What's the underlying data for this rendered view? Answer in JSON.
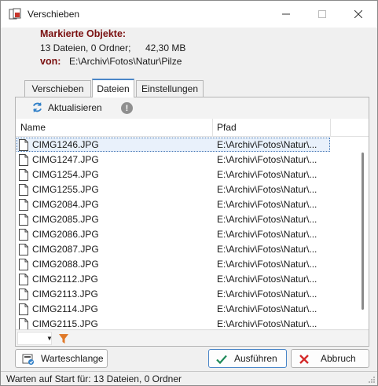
{
  "window": {
    "title": "Verschieben"
  },
  "header": {
    "marked_label": "Markierte Objekte:",
    "counts": "13 Dateien, 0 Ordner;",
    "size": "42,30 MB",
    "from_label": "von:",
    "from_path": "E:\\Archiv\\Fotos\\Natur\\Pilze"
  },
  "tabs": [
    {
      "label": "Verschieben"
    },
    {
      "label": "Dateien",
      "active": true
    },
    {
      "label": "Einstellungen"
    }
  ],
  "toolbar": {
    "refresh_label": "Aktualisieren",
    "warning_glyph": "!"
  },
  "list": {
    "columns": {
      "name": "Name",
      "path": "Pfad"
    },
    "rows": [
      {
        "name": "CIMG1246.JPG",
        "path": "E:\\Archiv\\Fotos\\Natur\\..."
      },
      {
        "name": "CIMG1247.JPG",
        "path": "E:\\Archiv\\Fotos\\Natur\\..."
      },
      {
        "name": "CIMG1254.JPG",
        "path": "E:\\Archiv\\Fotos\\Natur\\..."
      },
      {
        "name": "CIMG1255.JPG",
        "path": "E:\\Archiv\\Fotos\\Natur\\..."
      },
      {
        "name": "CIMG2084.JPG",
        "path": "E:\\Archiv\\Fotos\\Natur\\..."
      },
      {
        "name": "CIMG2085.JPG",
        "path": "E:\\Archiv\\Fotos\\Natur\\..."
      },
      {
        "name": "CIMG2086.JPG",
        "path": "E:\\Archiv\\Fotos\\Natur\\..."
      },
      {
        "name": "CIMG2087.JPG",
        "path": "E:\\Archiv\\Fotos\\Natur\\..."
      },
      {
        "name": "CIMG2088.JPG",
        "path": "E:\\Archiv\\Fotos\\Natur\\..."
      },
      {
        "name": "CIMG2112.JPG",
        "path": "E:\\Archiv\\Fotos\\Natur\\..."
      },
      {
        "name": "CIMG2113.JPG",
        "path": "E:\\Archiv\\Fotos\\Natur\\..."
      },
      {
        "name": "CIMG2114.JPG",
        "path": "E:\\Archiv\\Fotos\\Natur\\..."
      },
      {
        "name": "CIMG2115.JPG",
        "path": "E:\\Archiv\\Fotos\\Natur\\..."
      }
    ]
  },
  "buttons": {
    "queue": "Warteschlange",
    "execute": "Ausführen",
    "cancel": "Abbruch"
  },
  "status": {
    "text": "Warten auf Start für: 13 Dateien, 0 Ordner"
  },
  "colors": {
    "label_red": "#7a1010",
    "accent_blue": "#4a86c8",
    "selection_bg": "#e9f1fb",
    "execute_green": "#1f8a5a",
    "cancel_red": "#d42a2a",
    "filter_orange": "#e07a2a"
  }
}
